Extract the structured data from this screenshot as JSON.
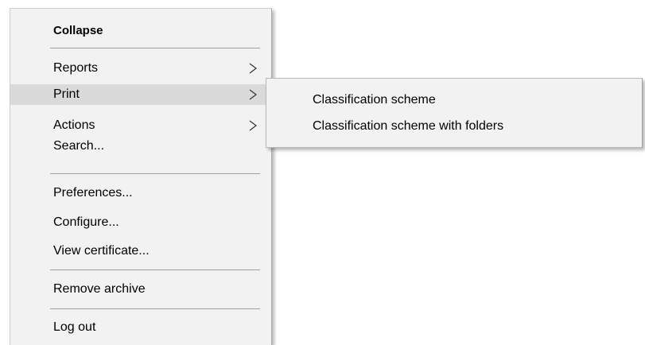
{
  "context_menu": {
    "items": [
      {
        "label": "Collapse",
        "bold": true
      },
      {
        "label": "Reports",
        "has_submenu": true
      },
      {
        "label": "Print",
        "has_submenu": true,
        "highlighted": true
      },
      {
        "label": "Actions",
        "has_submenu": true
      },
      {
        "label": "Search..."
      },
      {
        "label": "Preferences..."
      },
      {
        "label": "Configure..."
      },
      {
        "label": "View certificate..."
      },
      {
        "label": "Remove archive"
      },
      {
        "label": "Log out"
      }
    ],
    "chevron_icon": "chevron-right-icon"
  },
  "print_submenu": {
    "items": [
      {
        "label": "Classification scheme"
      },
      {
        "label": "Classification scheme with folders"
      }
    ]
  },
  "colors": {
    "menu_bg": "#f2f2f2",
    "highlight_bg": "#dadada",
    "separator": "#a0a0a0"
  }
}
